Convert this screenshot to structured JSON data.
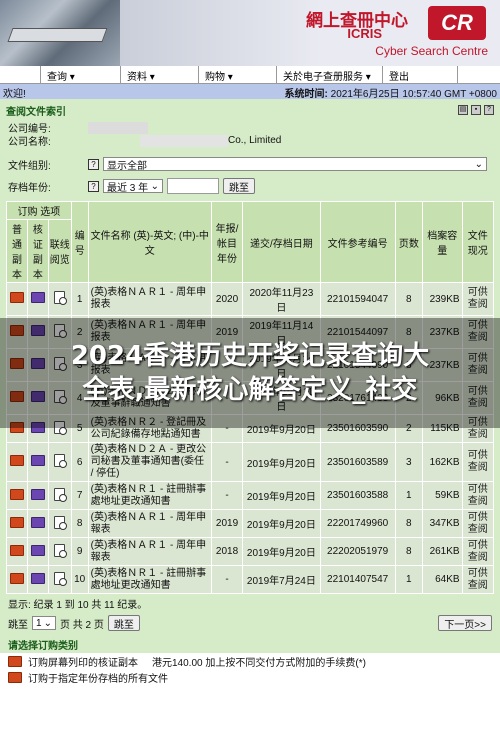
{
  "banner": {
    "logo_cn": "網上查冊中心",
    "logo_en": "ICRIS",
    "logo_badge": "CR",
    "logo_sub": "Cyber Search Centre"
  },
  "menu": [
    {
      "label": "查询 ▾"
    },
    {
      "label": "资料 ▾"
    },
    {
      "label": "购物 ▾"
    },
    {
      "label": "关於电子查册服务 ▾"
    },
    {
      "label": "登出"
    }
  ],
  "welcome": {
    "greeting": "欢迎!",
    "time_label": "系统时间:",
    "time_value": "2021年6月25日 10:57:40 GMT +0800"
  },
  "index": {
    "title": "查阅文件索引",
    "company_no_label": "公司编号:",
    "company_name_label": "公司名称:",
    "company_name_suffix": "Co., Limited",
    "doc_group_label": "文件组别:",
    "doc_group_value": "显示全部",
    "year_label": "存档年份:",
    "year_value": "最近 3 年",
    "jump_button": "跳至"
  },
  "table": {
    "header_order": "订购 选项",
    "header_normal": "普通副本",
    "header_certified": "核证副本",
    "header_link": "联线阅览",
    "header_no": "编号",
    "header_name": "文件名称 (英)-英文; (中)-中文",
    "header_year": "年报/帐目年份",
    "header_date": "递交/存档日期",
    "header_ref": "文件参考编号",
    "header_pages": "页数",
    "header_size": "档案容量",
    "header_status": "文件现况",
    "rows": [
      {
        "no": "1",
        "name": "(英)表格ＮＡＲ１ - 周年申报表",
        "year": "2020",
        "date": "2020年11月23日",
        "ref": "22101594047",
        "pages": "8",
        "size": "239KB",
        "status": "可供查阅"
      },
      {
        "no": "2",
        "name": "(英)表格ＮＡＲ１ - 周年申报表",
        "year": "2019",
        "date": "2019年11月14日",
        "ref": "22101544097",
        "pages": "8",
        "size": "237KB",
        "status": "可供查阅"
      },
      {
        "no": "3",
        "name": "(英)表格ＮＡＲ１ - 周年申报表",
        "year": "-",
        "date": "2019年11月14日",
        "ref": "22101544090",
        "pages": "8",
        "size": "237KB",
        "status": "可供查阅"
      },
      {
        "no": "4",
        "name": "(英)表格ＮＤ４ - 公司秘书及董事辭職通知書",
        "year": "-",
        "date": "2019年10月11日",
        "ref": "23201761433",
        "pages": "2",
        "size": "96KB",
        "status": "可供查阅"
      },
      {
        "no": "5",
        "name": "(英)表格ＮＲ２ - 登記冊及公司紀錄備存地點通知書",
        "year": "-",
        "date": "2019年9月20日",
        "ref": "23501603590",
        "pages": "2",
        "size": "115KB",
        "status": "可供查阅"
      },
      {
        "no": "6",
        "name": "(英)表格ＮＤ２Ａ - 更改公司秘書及董事通知書(委任 / 停任)",
        "year": "-",
        "date": "2019年9月20日",
        "ref": "23501603589",
        "pages": "3",
        "size": "162KB",
        "status": "可供查阅"
      },
      {
        "no": "7",
        "name": "(英)表格ＮＲ１ - 註冊辦事處地址更改通知書",
        "year": "-",
        "date": "2019年9月20日",
        "ref": "23501603588",
        "pages": "1",
        "size": "59KB",
        "status": "可供查阅"
      },
      {
        "no": "8",
        "name": "(英)表格ＮＡＲ１ - 周年申報表",
        "year": "2019",
        "date": "2019年9月20日",
        "ref": "22201749960",
        "pages": "8",
        "size": "347KB",
        "status": "可供查阅"
      },
      {
        "no": "9",
        "name": "(英)表格ＮＡＲ１ - 周年申報表",
        "year": "2018",
        "date": "2019年9月20日",
        "ref": "22202051979",
        "pages": "8",
        "size": "261KB",
        "status": "可供查阅"
      },
      {
        "no": "10",
        "name": "(英)表格ＮＲ１ - 註冊辦事處地址更改通知書",
        "year": "-",
        "date": "2019年7月24日",
        "ref": "22101407547",
        "pages": "1",
        "size": "64KB",
        "status": "可供查阅"
      }
    ]
  },
  "pagination": {
    "summary": "显示: 纪录 1 到 10 共 11 纪录。",
    "jump_label": "跳至",
    "page_value": "1",
    "page_text": "页 共 2 页",
    "jump_button": "跳至",
    "next_button": "下一页>>"
  },
  "order": {
    "title": "请选择订购类别",
    "option1_label": "订购屏幕列印的核证副本",
    "option1_fee": "港元140.00 加上按不同交付方式附加的手续费(*)",
    "option2_label": "订购于指定年份存档的所有文件"
  },
  "overlay": {
    "line1": "2024香港历史开奖记录查询大",
    "line2": "全表,最新核心解答定义_社交"
  }
}
